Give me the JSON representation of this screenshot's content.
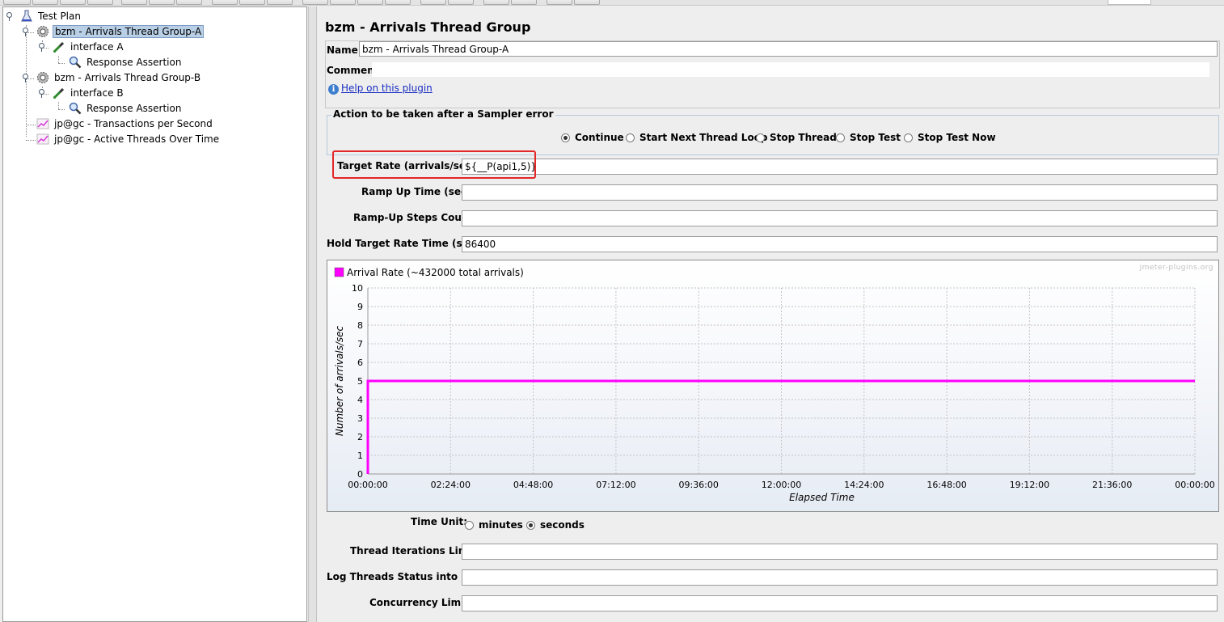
{
  "tree": {
    "items": [
      {
        "label": "Test Plan",
        "icon": "flask-icon"
      },
      {
        "label": "bzm - Arrivals Thread Group-A",
        "icon": "gear-icon",
        "selected": true
      },
      {
        "label": "interface A",
        "icon": "pipette-icon"
      },
      {
        "label": "Response Assertion",
        "icon": "magnifier-icon"
      },
      {
        "label": "bzm - Arrivals Thread Group-B",
        "icon": "gear-icon"
      },
      {
        "label": "interface B",
        "icon": "pipette-icon"
      },
      {
        "label": "Response Assertion",
        "icon": "magnifier-icon"
      },
      {
        "label": "jp@gc - Transactions per Second",
        "icon": "graph-icon"
      },
      {
        "label": "jp@gc - Active Threads Over Time",
        "icon": "graph-icon"
      }
    ]
  },
  "panel": {
    "title": "bzm - Arrivals Thread Group",
    "name_label": "Name:",
    "name_value": "bzm - Arrivals Thread Group-A",
    "comments_label": "Comments:",
    "help_link": "Help on this plugin",
    "sampler_error": {
      "title": "Action to be taken after a Sampler error",
      "options": [
        "Continue",
        "Start Next Thread Loop",
        "Stop Thread",
        "Stop Test",
        "Stop Test Now"
      ],
      "selected": "Continue"
    },
    "fields": {
      "target_rate": {
        "label": "Target Rate (arrivals/sec):",
        "value": "${__P(api1,5)}"
      },
      "ramp_up_time": {
        "label": "Ramp Up Time (sec):",
        "value": ""
      },
      "ramp_up_steps": {
        "label": "Ramp-Up Steps Count:",
        "value": ""
      },
      "hold_time": {
        "label": "Hold Target Rate Time (sec):",
        "value": "86400"
      }
    },
    "time_unit": {
      "label": "Time Unit:",
      "options": [
        "minutes",
        "seconds"
      ],
      "selected": "seconds"
    },
    "thread_iterations": {
      "label": "Thread Iterations Limit:",
      "value": ""
    },
    "log_threads": {
      "label": "Log Threads Status into File:",
      "value": ""
    },
    "concurrency": {
      "label": "Concurrency Limit:",
      "value": ""
    }
  },
  "chart_data": {
    "type": "line",
    "watermark": "jmeter-plugins.org",
    "xlabel": "Elapsed Time",
    "ylabel": "Number of arrivals/sec",
    "ylim": [
      0,
      10
    ],
    "y_ticks": [
      "0",
      "1",
      "2",
      "3",
      "4",
      "5",
      "6",
      "7",
      "8",
      "9",
      "10"
    ],
    "x_ticks": [
      "00:00:00",
      "02:24:00",
      "04:48:00",
      "07:12:00",
      "09:36:00",
      "12:00:00",
      "14:24:00",
      "16:48:00",
      "19:12:00",
      "21:36:00",
      "00:00:00"
    ],
    "grid": true,
    "legend_position": "top-left",
    "series": [
      {
        "name": "Arrival Rate (~432000 total arrivals)",
        "color": "#ff00ff",
        "x_seconds": [
          0,
          0,
          86400
        ],
        "values": [
          0,
          5,
          5
        ]
      }
    ]
  }
}
